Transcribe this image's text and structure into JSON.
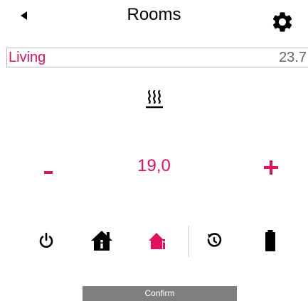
{
  "header": {
    "title": "Rooms",
    "back_icon": "back-arrow-icon",
    "settings_icon": "gear-icon"
  },
  "room": {
    "name": "Living",
    "temperature": "23.7"
  },
  "mode_indicator": {
    "icon": "heating-icon"
  },
  "setpoint": {
    "value": "19,0",
    "decrease_icon": "minus-icon",
    "increase_icon": "plus-icon"
  },
  "modes": [
    {
      "icon": "power-icon"
    },
    {
      "icon": "home-icon"
    },
    {
      "icon": "home-info-icon",
      "active": true
    },
    {
      "icon": "timer-icon"
    },
    {
      "icon": "battery-icon"
    }
  ],
  "confirm": {
    "label": "Confirm"
  },
  "colors": {
    "accent": "#e0115f",
    "text": "#000000",
    "muted": "#666666",
    "button_bg": "#7f7f7f",
    "border": "#b9b9b9"
  }
}
